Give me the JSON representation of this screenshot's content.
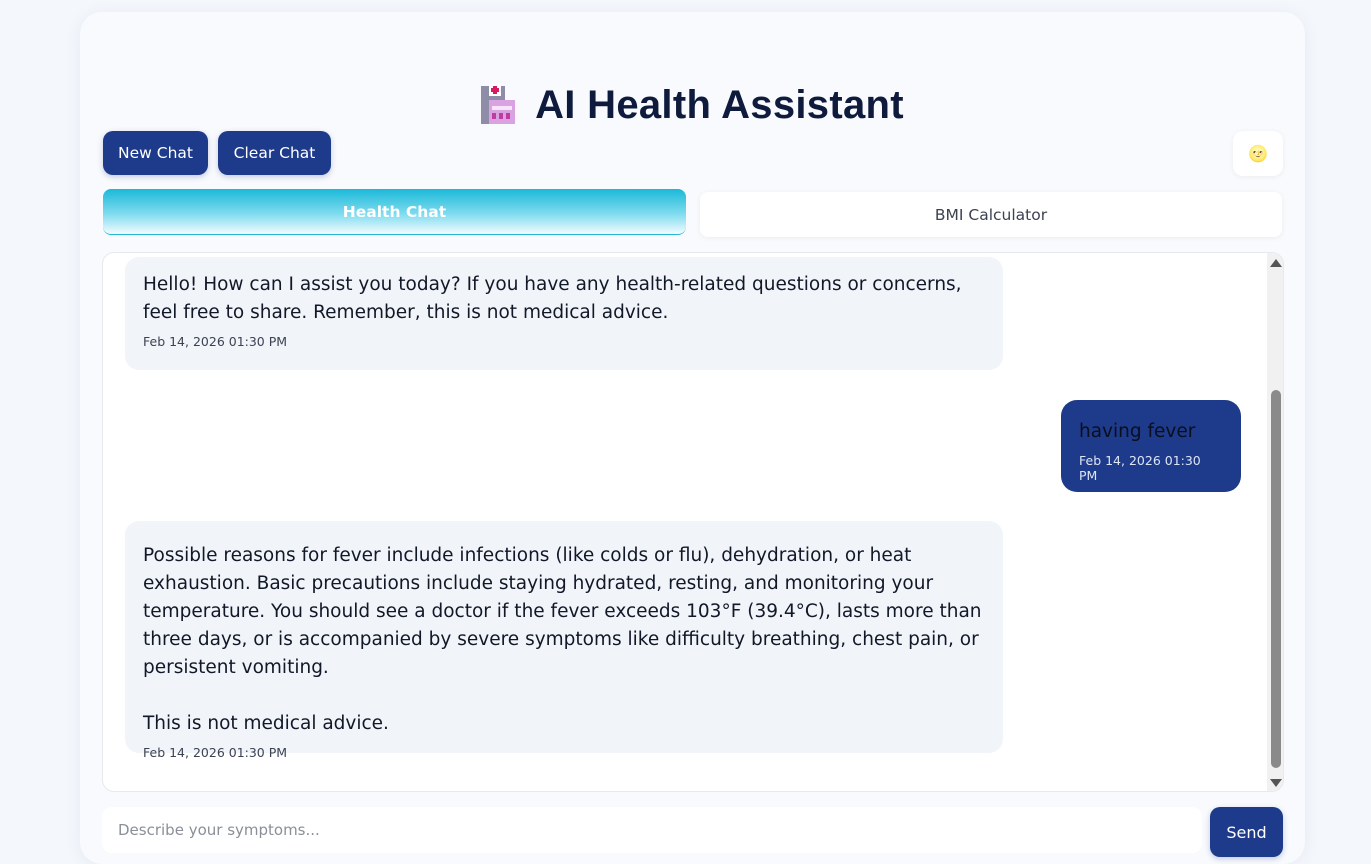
{
  "header": {
    "title": "AI Health Assistant",
    "icon": "hospital-icon"
  },
  "toolbar": {
    "new_chat_label": "New Chat",
    "clear_chat_label": "Clear Chat",
    "theme_toggle_icon": "🌝"
  },
  "tabs": [
    {
      "label": "Health Chat",
      "active": true
    },
    {
      "label": "BMI Calculator",
      "active": false
    }
  ],
  "messages": [
    {
      "role": "assistant",
      "text": "Hello! How can I assist you today? If you have any health-related questions or concerns, feel free to share. Remember, this is not medical advice.",
      "time": "Feb 14, 2026 01:30 PM"
    },
    {
      "role": "user",
      "text": "having fever",
      "time": "Feb 14, 2026 01:30 PM"
    },
    {
      "role": "assistant",
      "text": "Possible reasons for fever include infections (like colds or flu), dehydration, or heat exhaustion. Basic precautions include staying hydrated, resting, and monitoring your temperature. You should see a doctor if the fever exceeds 103°F (39.4°C), lasts more than three days, or is accompanied by severe symptoms like difficulty breathing, chest pain, or persistent vomiting.\n\nThis is not medical advice.",
      "time": "Feb 14, 2026 01:30 PM"
    }
  ],
  "composer": {
    "placeholder": "Describe your symptoms...",
    "send_label": "Send"
  },
  "colors": {
    "primary": "#1e3a8a",
    "tab_accent": "#1bb9d9",
    "bot_bubble": "#f1f4f9",
    "title": "#0f1b3d"
  }
}
